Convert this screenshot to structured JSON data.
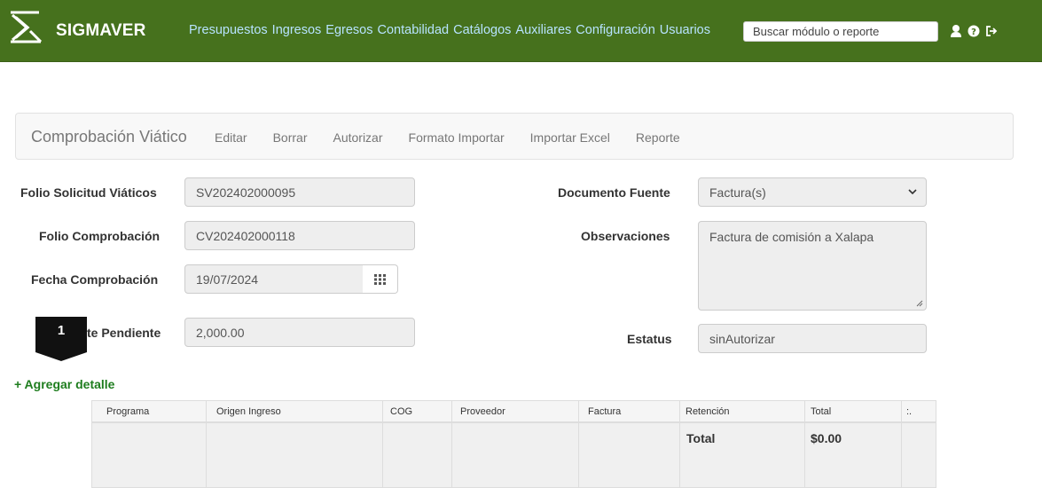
{
  "navbar": {
    "brand": "SIGMAVER",
    "menu": [
      "Presupuestos",
      "Ingresos",
      "Egresos",
      "Contabilidad",
      "Catálogos",
      "Auxiliares",
      "Configuración",
      "Usuarios"
    ],
    "search_placeholder": "Buscar módulo o reporte",
    "icons": [
      "user-icon",
      "help-icon",
      "logout-icon"
    ],
    "bg_color": "#46711d",
    "link_color": "#b7e3ff"
  },
  "toolbar": {
    "title": "Comprobación Viático",
    "actions": [
      "Editar",
      "Borrar",
      "Autorizar",
      "Formato Importar",
      "Importar Excel",
      "Reporte"
    ]
  },
  "form": {
    "folio_solicitud": {
      "label": "Folio Solicitud Viáticos",
      "value": "SV202402000095"
    },
    "folio_comprobacion": {
      "label": "Folio Comprobación",
      "value": "CV202402000118"
    },
    "fecha_comprobacion": {
      "label": "Fecha Comprobación",
      "value": "19/07/2024"
    },
    "importe_pendiente": {
      "label": "te Pendiente",
      "value": "2,000.00"
    },
    "documento_fuente": {
      "label": "Documento Fuente",
      "value": "Factura(s)"
    },
    "observaciones": {
      "label": "Observaciones",
      "value": "Factura de comisión a Xalapa"
    },
    "estatus": {
      "label": "Estatus",
      "value": "sinAutorizar"
    }
  },
  "badge": {
    "number": "1"
  },
  "add_detail": "+ Agregar detalle",
  "table": {
    "headers": [
      "Programa",
      "Origen Ingreso",
      "COG",
      "Proveedor",
      "Factura",
      "Retención",
      "Total",
      ":."
    ],
    "total_label": "Total",
    "total_value": "$0.00"
  }
}
